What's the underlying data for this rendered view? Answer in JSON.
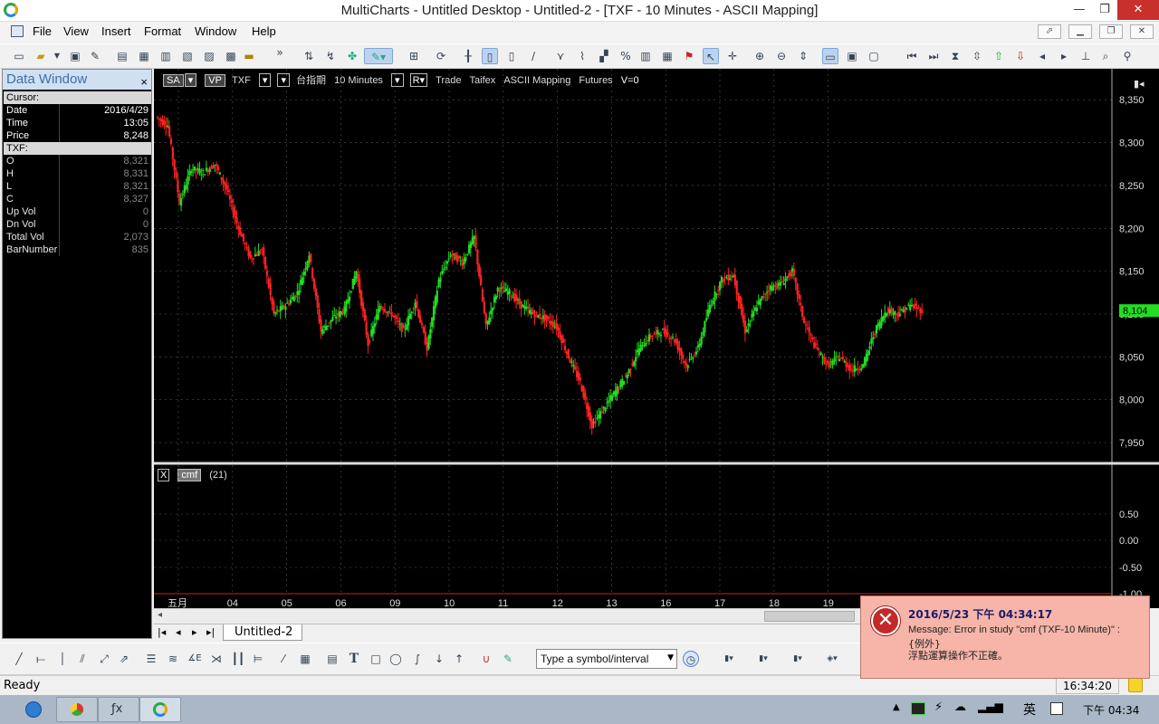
{
  "window": {
    "title": "MultiCharts - Untitled Desktop - Untitled-2 - [TXF - 10 Minutes - ASCII Mapping]",
    "min": "—",
    "max": "❐",
    "close": "✕"
  },
  "menu": [
    "File",
    "View",
    "Insert",
    "Format",
    "Window",
    "Help"
  ],
  "mdi_controls": [
    "⬀",
    "▁",
    "❐",
    "✕"
  ],
  "data_window": {
    "title": "Data Window",
    "close": "×",
    "cursor_label": "Cursor:",
    "cursor_rows": [
      {
        "k": "Date",
        "v": "2016/4/29"
      },
      {
        "k": "Time",
        "v": "13:05"
      },
      {
        "k": "Price",
        "v": "8,248"
      }
    ],
    "symbol_label": "TXF:",
    "symbol_rows": [
      {
        "k": "O",
        "v": "8,321"
      },
      {
        "k": "H",
        "v": "8,331"
      },
      {
        "k": "L",
        "v": "8,321"
      },
      {
        "k": "C",
        "v": "8,327"
      },
      {
        "k": "Up Vol",
        "v": "0"
      },
      {
        "k": "Dn Vol",
        "v": "0"
      },
      {
        "k": "Total Vol",
        "v": "2,073"
      },
      {
        "k": "BarNumber",
        "v": "835"
      }
    ]
  },
  "chart_header": {
    "sa": "SA",
    "vp": "VP",
    "symbol": "TXF",
    "desc": "台指期",
    "interval": "10 Minutes",
    "r": "R",
    "trade": "Trade",
    "exchange": "Taifex",
    "mapping": "ASCII Mapping",
    "category": "Futures",
    "volume": "V=0"
  },
  "indicator": {
    "close": "X",
    "name": "cmf",
    "param": "(21)"
  },
  "chart_data": {
    "type": "line",
    "price_axis": {
      "ticks": [
        "8,350",
        "8,300",
        "8,250",
        "8,200",
        "8,150",
        "8,100",
        "8,050",
        "8,000",
        "7,950"
      ],
      "ylim": [
        7930,
        8365
      ],
      "last_price": "8,104",
      "last_price_value": 8104
    },
    "indicator_axis": {
      "ticks": [
        "0.50",
        "0.00",
        "-0.50",
        "-1.00"
      ]
    },
    "x_ticks": [
      "五月",
      "04",
      "05",
      "06",
      "09",
      "10",
      "11",
      "12",
      "13",
      "16",
      "17",
      "18",
      "19"
    ],
    "series": [
      {
        "values": [
          8330,
          8320,
          8230,
          8270,
          8265,
          8275,
          8245,
          8200,
          8165,
          8175,
          8100,
          8110,
          8125,
          8170,
          8080,
          8095,
          8105,
          8150,
          8065,
          8110,
          8100,
          8080,
          8115,
          8060,
          8140,
          8170,
          8160,
          8190,
          8085,
          8130,
          8125,
          8110,
          8100,
          8095,
          8085,
          8050,
          8020,
          7970,
          7990,
          8010,
          8030,
          8060,
          8075,
          8080,
          8070,
          8040,
          8060,
          8110,
          8140,
          8145,
          8080,
          8110,
          8130,
          8135,
          8150,
          8090,
          8060,
          8040,
          8050,
          8035,
          8040,
          8080,
          8105,
          8100,
          8110,
          8104
        ]
      }
    ]
  },
  "tabs": {
    "active": "Untitled-2"
  },
  "symbol_input": {
    "placeholder": "Type a symbol/interval"
  },
  "status": {
    "left": "Ready",
    "time": "16:34:20"
  },
  "taskbar": {
    "lang": "英",
    "clock": "下午 04:34"
  },
  "error": {
    "datetime": "2016/5/23 下午 04:34:17",
    "message": "Message: Error in study \"cmf (TXF-10 Minute)\" :",
    "line2": "{例外}",
    "line3": "浮點運算操作不正確。"
  },
  "colors": {
    "up": "#22dd22",
    "down": "#ff2222",
    "bg": "#000000",
    "grid": "#555555"
  }
}
